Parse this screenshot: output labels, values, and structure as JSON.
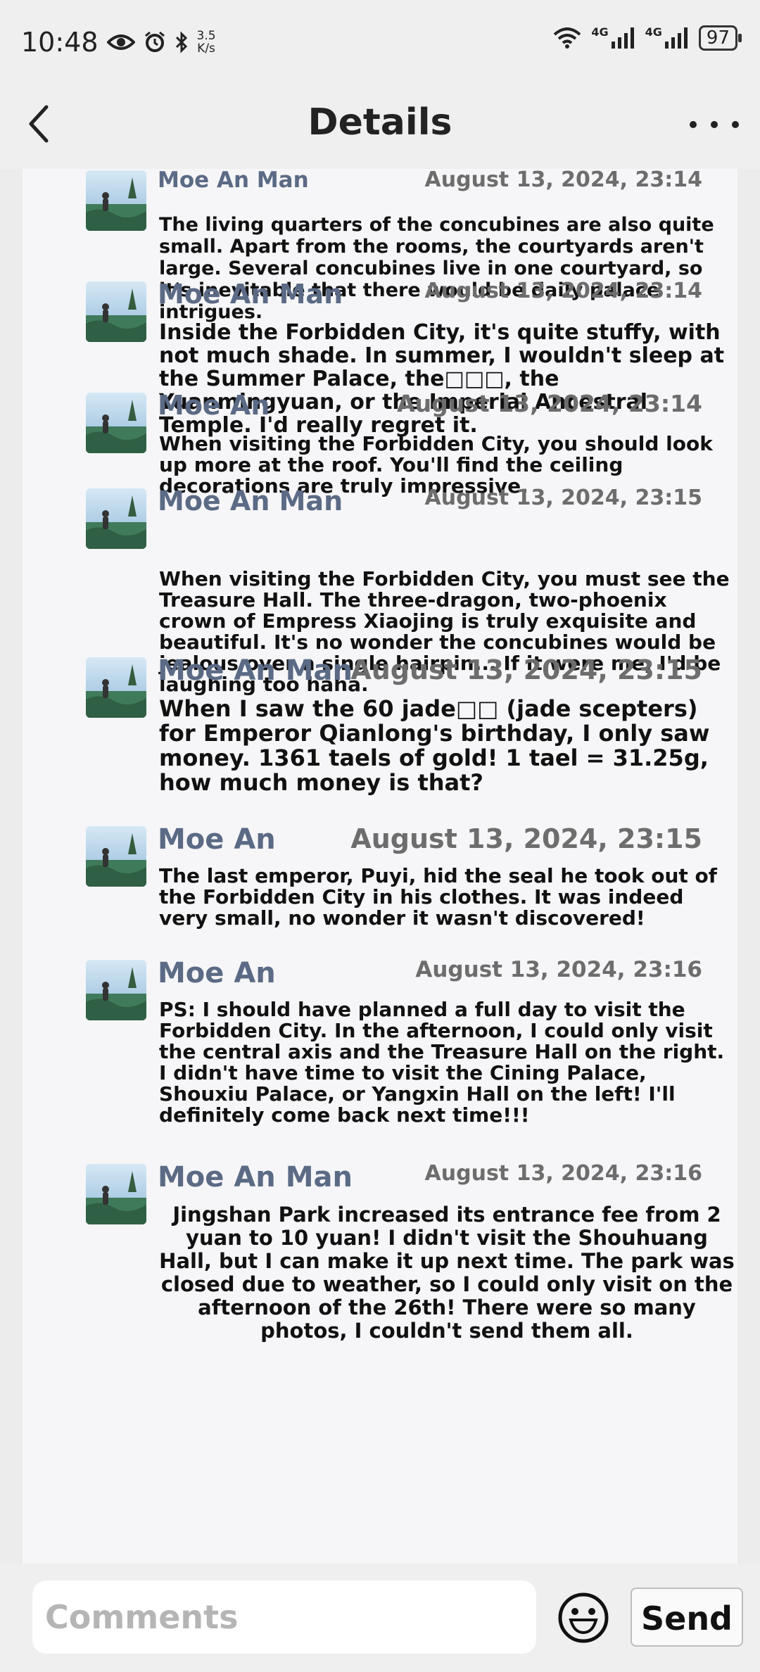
{
  "status_bar": {
    "time": "10:48",
    "speed_value": "3.5",
    "speed_unit": "K/s",
    "net1": "4G",
    "net2": "4G",
    "battery": "97",
    "icons": [
      "eye-icon",
      "alarm-icon",
      "bluetooth-icon",
      "wifi-icon",
      "signal-icon",
      "battery-icon"
    ]
  },
  "app_bar": {
    "title": "Details"
  },
  "comments": [
    {
      "name": "Moe An Man",
      "time": "August 13, 2024, 23:14",
      "text": "The living quarters of the concubines are also quite small. Apart from the rooms, the courtyards aren't large. Several concubines live in one courtyard, so it's inevitable that there would be daily palace intrigues."
    },
    {
      "name": "Moe An Man",
      "time": "August 13, 2024, 23:14",
      "text": "Inside the Forbidden City, it's quite stuffy, with not much shade. In summer, I wouldn't sleep at the Summer Palace, the□□□, the Yuanmingyuan, or the Imperial Ancestral Temple. I'd really regret it."
    },
    {
      "name": "Moe An",
      "time": "August 13, 2024, 23:14",
      "text": "When visiting the Forbidden City, you should look up more at the roof. You'll find the ceiling decorations are truly impressive."
    },
    {
      "name": "Moe An Man",
      "time": "August 13, 2024, 23:15",
      "text": "When visiting the Forbidden City, you must see the Treasure Hall. The three-dragon, two-phoenix crown of Empress Xiaojing is truly exquisite and beautiful. It's no wonder the concubines would be jealous over a single hairpin... If it were me, I'd be laughing too haha."
    },
    {
      "name": "Moe An Man",
      "time": "August 13, 2024, 23:15",
      "text": "When I saw the 60 jade□□ (jade scepters) for Emperor Qianlong's birthday, I only saw money. 1361 taels of gold! 1 tael = 31.25g, how much money is that?"
    },
    {
      "name": "Moe An",
      "time": "August 13, 2024, 23:15",
      "text": "The last emperor, Puyi, hid the seal he took out of the Forbidden City in his clothes. It was indeed very small, no wonder it wasn't discovered!"
    },
    {
      "name": "Moe An",
      "time": "August 13, 2024, 23:16",
      "text": "PS: I should have planned a full day to visit the Forbidden City. In the afternoon, I could only visit the central axis and the Treasure Hall on the right. I didn't have time to visit the Cining Palace, Shouxiu Palace, or Yangxin Hall on the left! I'll definitely come back next time!!!"
    },
    {
      "name": "Moe An Man",
      "time": "August 13, 2024, 23:16",
      "text": "Jingshan Park increased its entrance fee from 2 yuan to 10 yuan! I didn't visit the Shouhuang Hall, but I can make it up next time. The park was closed due to weather, so I could only visit on the afternoon of the 26th! There were so many photos, I couldn't send them all."
    }
  ],
  "bottom_bar": {
    "placeholder": "Comments",
    "send_label": "Send"
  }
}
